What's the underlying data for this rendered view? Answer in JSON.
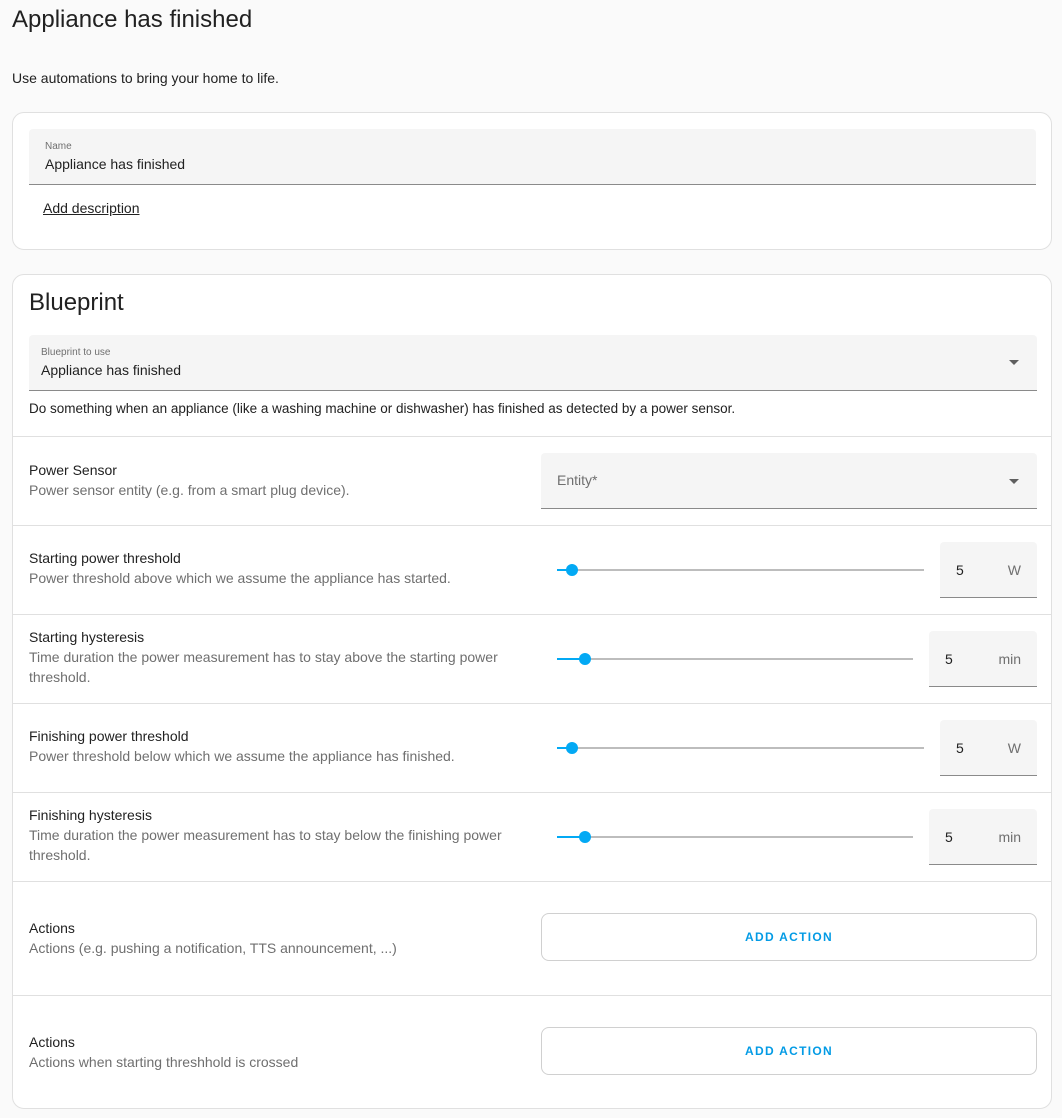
{
  "page": {
    "title": "Appliance has finished",
    "intro": "Use automations to bring your home to life."
  },
  "name_card": {
    "name_label": "Name",
    "name_value": "Appliance has finished",
    "add_description": "Add description"
  },
  "blueprint": {
    "heading": "Blueprint",
    "select_label": "Blueprint to use",
    "select_value": "Appliance has finished",
    "description": "Do something when an appliance (like a washing machine or dishwasher) has finished as detected by a power sensor."
  },
  "inputs": {
    "power_sensor": {
      "title": "Power Sensor",
      "description": "Power sensor entity (e.g. from a smart plug device).",
      "placeholder": "Entity*"
    },
    "starting_threshold": {
      "title": "Starting power threshold",
      "description": "Power threshold above which we assume the appliance has started.",
      "value": "5",
      "unit": "W",
      "fraction": 0.04
    },
    "starting_hysteresis": {
      "title": "Starting hysteresis",
      "description": "Time duration the power measurement has to stay above the starting power threshold.",
      "value": "5",
      "unit": "min",
      "fraction": 0.08
    },
    "finishing_threshold": {
      "title": "Finishing power threshold",
      "description": "Power threshold below which we assume the appliance has finished.",
      "value": "5",
      "unit": "W",
      "fraction": 0.04
    },
    "finishing_hysteresis": {
      "title": "Finishing hysteresis",
      "description": "Time duration the power measurement has to stay below the finishing power threshold.",
      "value": "5",
      "unit": "min",
      "fraction": 0.08
    },
    "actions": {
      "title": "Actions",
      "description": "Actions (e.g. pushing a notification, TTS announcement, ...)",
      "button_label": "ADD ACTION"
    },
    "pre_actions": {
      "title": "Actions",
      "description": "Actions when starting threshhold is crossed",
      "button_label": "ADD ACTION"
    }
  },
  "colors": {
    "accent": "#03a9f4",
    "button_text": "#039be5"
  }
}
